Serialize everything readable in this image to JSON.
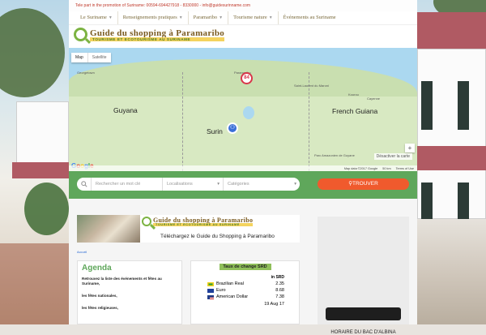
{
  "topbar": {
    "text": "Tele part in the promotion of Suriname: 00594-694427918 - 8330000 - info@guidesurinname.com"
  },
  "nav": {
    "items": [
      {
        "label": "Le Suriname",
        "dropdown": true
      },
      {
        "label": "Renseignements pratiques",
        "dropdown": true
      },
      {
        "label": "Paramaribo",
        "dropdown": true
      },
      {
        "label": "Tourisme nature",
        "dropdown": true
      },
      {
        "label": "Événements au Suriname",
        "dropdown": false
      }
    ]
  },
  "logo": {
    "title": "Guide du shopping à Paramaribo",
    "subtitle": "TOURISME ET ECOTOURISME AU SURINAME"
  },
  "map": {
    "tabs": {
      "map": "Map",
      "satellite": "Satellite"
    },
    "labels": {
      "guyana": "Guyana",
      "french_guiana": "French Guiana",
      "suriname": "Surin",
      "paramaribo": "Paramaribo",
      "georgetown": "Georgetown",
      "parc": "Parc Amazonien de Guyane",
      "saint_laurent": "Saint-Laurent du Maroni",
      "cayenne": "Cayenne",
      "kourou": "Kourou"
    },
    "cluster_count": "84",
    "pin_glyph": "⚇",
    "zoom_in": "+",
    "zoom_out": "−",
    "disable_button": "Désactiver la carte",
    "footer": {
      "data": "Map data ©2017 Google",
      "scale": "50 km",
      "terms": "Terms of Use"
    },
    "google": [
      "G",
      "o",
      "o",
      "g",
      "l",
      "e"
    ]
  },
  "search": {
    "placeholder": "Rechercher un mot clé",
    "location": "Localisations",
    "category": "Catégories",
    "find_button": "TROUVER"
  },
  "banner": {
    "title": "Guide du shopping à Paramaribo",
    "subtitle": "TOURISME ET ECOTOURISME AU SURINAME",
    "caption": "Téléchargez le Guide du Shopping à Paramaribo"
  },
  "breadcrumb": "Accueil",
  "agenda": {
    "title": "Agenda",
    "lines": [
      "Retrouvez la liste des événements et fêtes au Suriname,",
      "les fêtes nationales,",
      "les fêtes religieuses,"
    ]
  },
  "rates": {
    "title": "Taux de change SRD",
    "unit": "in SRD",
    "rows": [
      {
        "name": "Brazilian Real",
        "value": "2.35"
      },
      {
        "name": "Euro",
        "value": "8.68"
      },
      {
        "name": "American Dollar",
        "value": "7.38"
      }
    ],
    "date": "19 Aug 17"
  },
  "side": {
    "caption": "HORAIRE DU BAC D'ALBINA"
  },
  "colors": {
    "accent_green": "#5fa75b",
    "orange_button": "#f05a2d",
    "nav_text": "#7a6a3b"
  }
}
